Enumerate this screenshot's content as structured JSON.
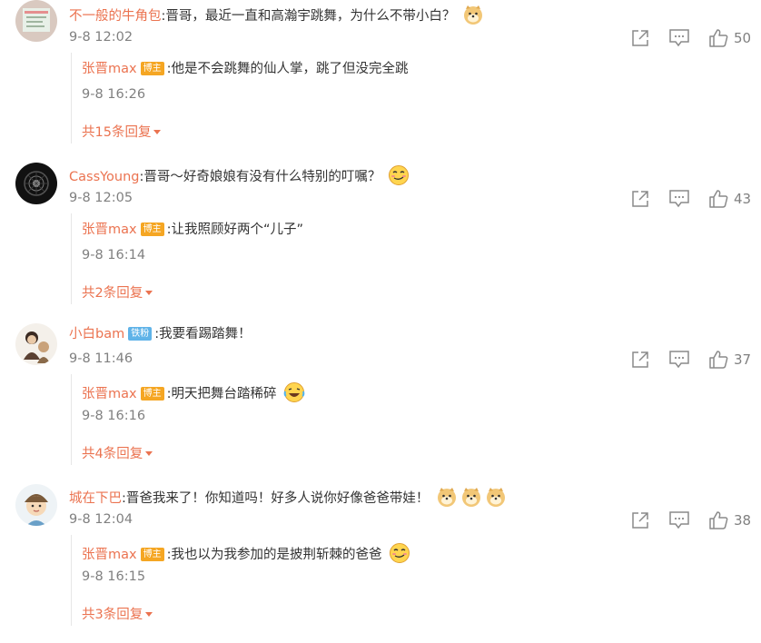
{
  "comments": [
    {
      "user": "不一般的牛角包",
      "text": ":晋哥，最近一直和高瀚宇跳舞，为什么不带小白？",
      "time": "9-8 12:02",
      "likes": "50",
      "reply": {
        "user": "张晋max",
        "badge": "博主",
        "text": ":他是不会跳舞的仙人掌，跳了但没完全跳",
        "time": "9-8 16:26"
      },
      "more": "共15条回复"
    },
    {
      "user": "CassYoung",
      "text": ":晋哥～好奇娘娘有没有什么特别的叮嘱？",
      "time": "9-8 12:05",
      "likes": "43",
      "reply": {
        "user": "张晋max",
        "badge": "博主",
        "text": ":让我照顾好两个“儿子”",
        "time": "9-8 16:14"
      },
      "more": "共2条回复"
    },
    {
      "user": "小白bam",
      "badge": "铁粉",
      "text": ":我要看踢踏舞！",
      "time": "9-8 11:46",
      "likes": "37",
      "reply": {
        "user": "张晋max",
        "badge": "博主",
        "text": ":明天把舞台踏稀碎",
        "time": "9-8 16:16"
      },
      "more": "共4条回复"
    },
    {
      "user": "城在下巴",
      "text": ":晋爸我来了！你知道吗！好多人说你好像爸爸带娃！",
      "time": "9-8 12:04",
      "likes": "38",
      "reply": {
        "user": "张晋max",
        "badge": "博主",
        "text": ":我也以为我参加的是披荆斩棘的爸爸",
        "time": "9-8 16:15"
      },
      "more": "共3条回复"
    }
  ],
  "icons": {
    "share": "share-icon",
    "comment": "comment-icon",
    "like": "thumbs-up-icon",
    "expand": "caret-down-icon"
  },
  "colors": {
    "username": "#eb7350",
    "meta": "#808080",
    "badge_blogger": "#f5a623",
    "badge_fan": "#5fb3e8"
  }
}
